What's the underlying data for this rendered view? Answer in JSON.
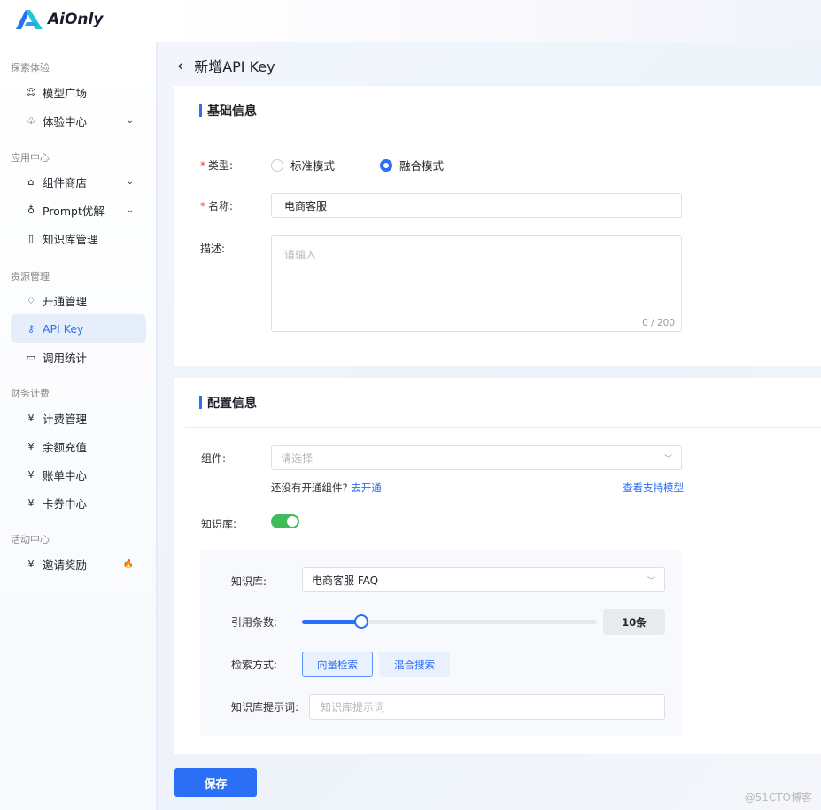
{
  "app": {
    "logo": "AiOnly"
  },
  "sidebar": {
    "groups": [
      "探索体验",
      "应用中心",
      "资源管理",
      "财务计费",
      "活动中心"
    ],
    "items": [
      {
        "label": "模型广场",
        "icon": "model-icon"
      },
      {
        "label": "体验中心",
        "icon": "experience-icon",
        "chevron": true
      },
      {
        "label": "组件商店",
        "icon": "store-icon",
        "chevron": true
      },
      {
        "label": "Prompt优解",
        "icon": "bulb-icon",
        "chevron": true
      },
      {
        "label": "知识库管理",
        "icon": "book-icon"
      },
      {
        "label": "开通管理",
        "icon": "diamond-icon"
      },
      {
        "label": "API Key",
        "icon": "key-icon",
        "active": true
      },
      {
        "label": "调用统计",
        "icon": "chart-icon"
      },
      {
        "label": "计费管理",
        "icon": "billing-icon"
      },
      {
        "label": "余额充值",
        "icon": "recharge-icon"
      },
      {
        "label": "账单中心",
        "icon": "bill-icon"
      },
      {
        "label": "卡券中心",
        "icon": "coupon-icon"
      },
      {
        "label": "邀请奖励",
        "icon": "invite-icon",
        "badge": "fire-icon"
      }
    ]
  },
  "page": {
    "title": "新增API Key",
    "save": "保存"
  },
  "basic": {
    "title": "基础信息",
    "type_label": "类型:",
    "type_options": [
      "标准模式",
      "融合模式"
    ],
    "type_selected": "融合模式",
    "name_label": "名称:",
    "name_value": "电商客服",
    "desc_label": "描述:",
    "desc_placeholder": "请输入",
    "desc_count": "0 / 200"
  },
  "config": {
    "title": "配置信息",
    "component_label": "组件:",
    "component_placeholder": "请选择",
    "no_component": "还没有开通组件?",
    "go_open": "去开通",
    "view_models": "查看支持模型",
    "kb_label": "知识库:",
    "kb_enabled": true,
    "kb": {
      "kb_label": "知识库:",
      "kb_value": "电商客服 FAQ",
      "ref_label": "引用条数:",
      "ref_value": "10条",
      "ref_fraction": 0.2,
      "search_label": "检索方式:",
      "search_options": [
        "向量检索",
        "混合搜索"
      ],
      "search_selected": "向量检索",
      "prompt_label": "知识库提示词:",
      "prompt_placeholder": "知识库提示词"
    }
  },
  "watermark": "@51CTO博客",
  "colors": {
    "accent": "#2a6ff5",
    "toggle": "#3fbd5a",
    "required": "#e53935"
  }
}
